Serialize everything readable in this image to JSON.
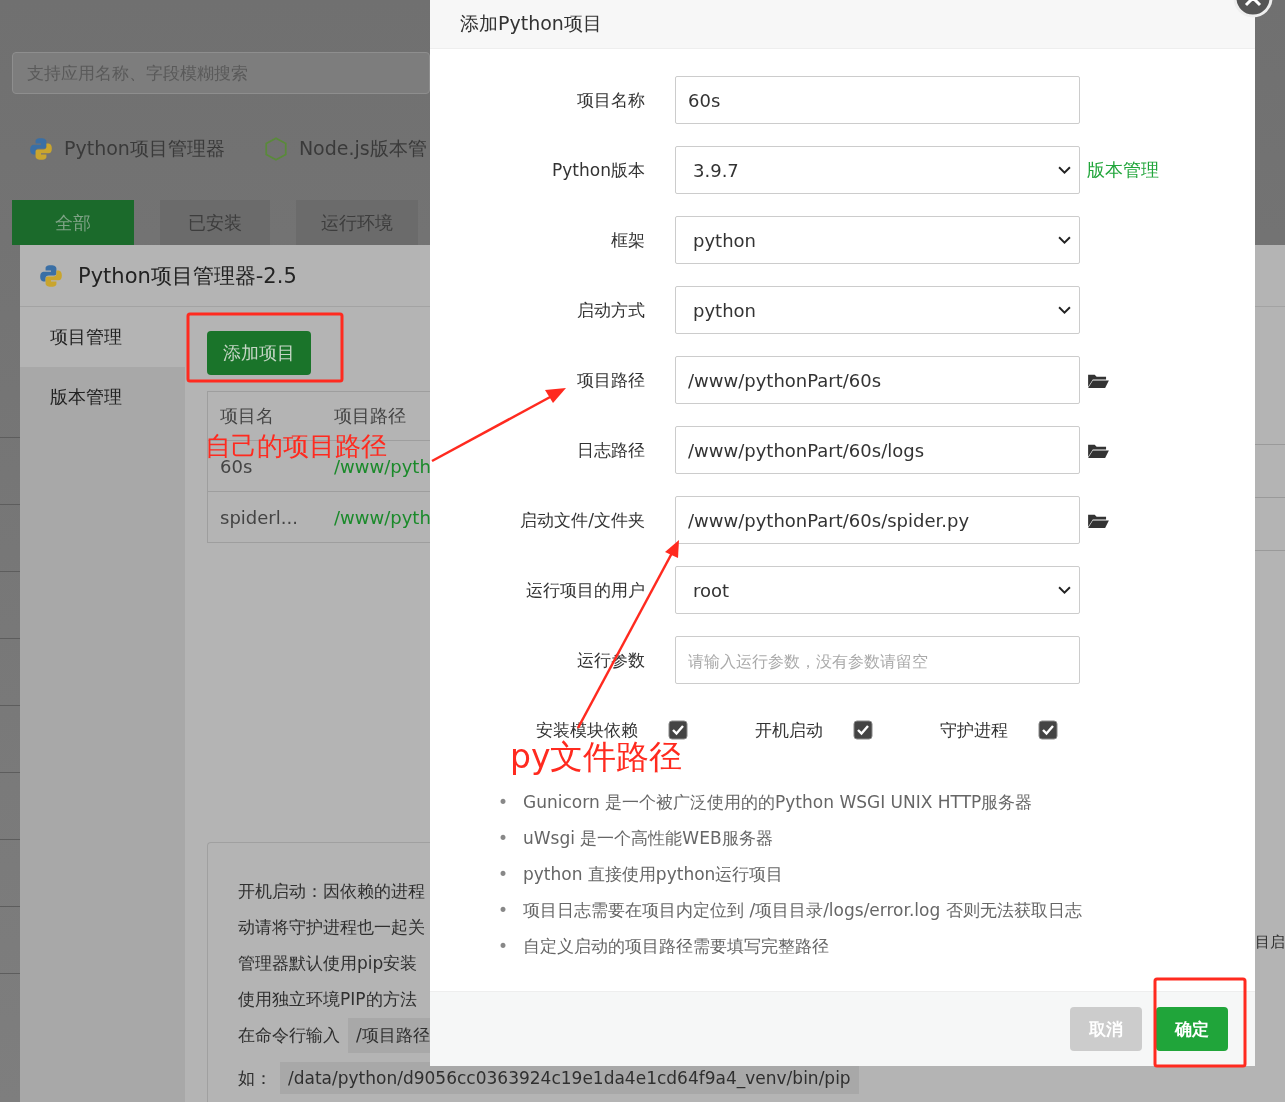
{
  "background": {
    "search": {
      "placeholder": "支持应用名称、字段模糊搜索"
    },
    "apps": [
      {
        "name": "Python项目管理器",
        "kind": "python"
      },
      {
        "name": "Node.js版本管",
        "kind": "node"
      }
    ],
    "categories": [
      {
        "label": "全部",
        "selected": true
      },
      {
        "label": "已安装",
        "selected": false
      },
      {
        "label": "运行环境",
        "selected": false
      }
    ]
  },
  "manager": {
    "title": "Python项目管理器-2.5",
    "nav": [
      {
        "label": "项目管理",
        "selected": true
      },
      {
        "label": "版本管理",
        "selected": false
      }
    ],
    "add_button": "添加项目",
    "table": {
      "columns": [
        "项目名",
        "项目路径"
      ],
      "rows": [
        [
          "60s",
          "/www/pyth"
        ],
        [
          "spiderl...",
          "/www/pyth"
        ]
      ]
    },
    "notes": [
      {
        "text": "开机启动：因依赖的进程"
      },
      {
        "text": "动请将守护进程也一起关"
      },
      {
        "text": "管理器默认使用pip安装"
      },
      {
        "text": "使用独立环境PIP的方法"
      },
      {
        "text": "在命令行输入",
        "code": "/项目路径"
      },
      {
        "text": "如：",
        "code": "/data/python/d9056cc0363924c19e1da4e1cd64f9a4_venv/bin/pip"
      }
    ],
    "right_fragment": "目启"
  },
  "dialog": {
    "title": "添加Python项目",
    "fields": [
      {
        "label": "项目名称",
        "kind": "text",
        "value": "60s"
      },
      {
        "label": "Python版本",
        "kind": "select",
        "value": "3.9.7",
        "link": "版本管理"
      },
      {
        "label": "框架",
        "kind": "select",
        "value": "python"
      },
      {
        "label": "启动方式",
        "kind": "select",
        "value": "python"
      },
      {
        "label": "项目路径",
        "kind": "path",
        "value": "/www/pythonPart/60s"
      },
      {
        "label": "日志路径",
        "kind": "path",
        "value": "/www/pythonPart/60s/logs"
      },
      {
        "label": "启动文件/文件夹",
        "kind": "path",
        "value": "/www/pythonPart/60s/spider.py"
      },
      {
        "label": "运行项目的用户",
        "kind": "select",
        "value": "root"
      },
      {
        "label": "运行参数",
        "kind": "text",
        "placeholder": "请输入运行参数，没有参数请留空"
      }
    ],
    "options": [
      {
        "label": "安装模块依赖",
        "checked": true
      },
      {
        "label": "开机启动",
        "checked": true
      },
      {
        "label": "守护进程",
        "checked": true
      }
    ],
    "tips": [
      {
        "bullet": "•",
        "text": "Gunicorn 是一个被广泛使用的的Python WSGI UNIX HTTP服务器"
      },
      {
        "bullet": "•",
        "text": "uWsgi 是一个高性能WEB服务器"
      },
      {
        "bullet": "•",
        "text": "python 直接使用python运行项目"
      },
      {
        "bullet": "•",
        "text": "项目日志需要在项目内定位到 /项目目录/logs/error.log 否则无法获取日志"
      },
      {
        "bullet": "•",
        "text": "自定义启动的项目路径需要填写完整路径"
      }
    ],
    "buttons": [
      {
        "label": "取消",
        "kind": "cancel"
      },
      {
        "label": "确定",
        "kind": "confirm"
      }
    ]
  },
  "annotations": [
    {
      "text": "自己的项目路径"
    },
    {
      "text": "py文件路径"
    }
  ]
}
